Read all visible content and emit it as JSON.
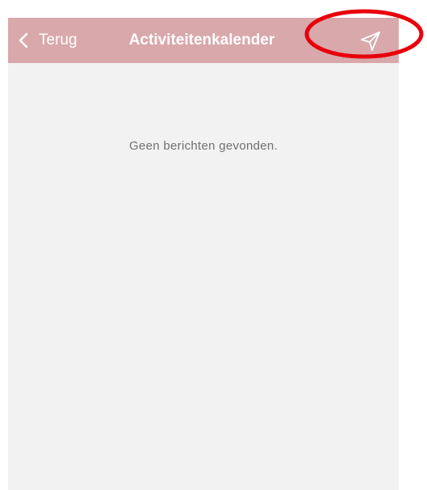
{
  "navbar": {
    "back_label": "Terug",
    "title": "Activiteitenkalender",
    "send_icon": "send-icon",
    "background": "#d9a8ab"
  },
  "content": {
    "empty_message": "Geen berichten gevonden.",
    "background": "#f2f2f2"
  },
  "annotation": {
    "shape": "ellipse",
    "color": "#e8000b",
    "target": "send-button"
  }
}
